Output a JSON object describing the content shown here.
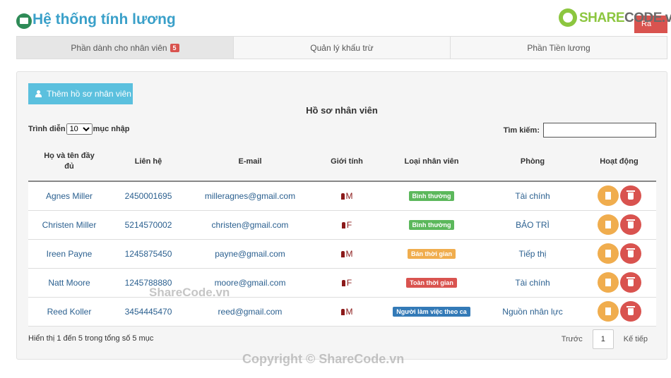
{
  "header": {
    "title": "Hệ thống tính lương",
    "exit_label": "Ra",
    "brand_share": "SHARE",
    "brand_code": "CODE.vn"
  },
  "tabs": [
    {
      "label": "Phần dành cho nhân viên",
      "badge": "5"
    },
    {
      "label": "Quản lý khấu trừ"
    },
    {
      "label": "Phần Tiền lương"
    }
  ],
  "panel": {
    "add_button": "Thêm hồ sơ nhân viên",
    "title": "Hồ sơ nhân viên",
    "show_label": "Trình diễn",
    "show_value": "10",
    "entries_label": "mục nhập",
    "search_label": "Tìm kiếm:",
    "search_value": ""
  },
  "table": {
    "headers": [
      "Họ và tên đầy đủ",
      "Liên hệ",
      "E-mail",
      "Giới tính",
      "Loại nhân viên",
      "Phòng",
      "Hoạt động"
    ],
    "rows": [
      {
        "name": "Agnes Miller",
        "phone": "2450001695",
        "email": "milleragnes@gmail.com",
        "gender": "M",
        "type": "Bình thường",
        "type_color": "#5cb85c",
        "dept": "Tài chính"
      },
      {
        "name": "Christen Miller",
        "phone": "5214570002",
        "email": "christen@gmail.com",
        "gender": "F",
        "type": "Bình thường",
        "type_color": "#5cb85c",
        "dept": "BẢO TRÌ"
      },
      {
        "name": "Ireen Payne",
        "phone": "1245875450",
        "email": "payne@gmail.com",
        "gender": "M",
        "type": "Bán thời gian",
        "type_color": "#f0ad4e",
        "dept": "Tiếp thị"
      },
      {
        "name": "Natt Moore",
        "phone": "1245788880",
        "email": "moore@gmail.com",
        "gender": "F",
        "type": "Toàn thời gian",
        "type_color": "#d9534f",
        "dept": "Tài chính"
      },
      {
        "name": "Reed Koller",
        "phone": "3454445470",
        "email": "reed@gmail.com",
        "gender": "M",
        "type": "Người làm việc theo ca",
        "type_color": "#337ab7",
        "dept": "Nguồn nhân lực"
      }
    ]
  },
  "footer": {
    "info": "Hiển thị 1 đến 5 trong tổng số 5 mục",
    "prev": "Trước",
    "page": "1",
    "next": "Kế tiếp"
  },
  "watermarks": {
    "inline": "ShareCode.vn",
    "copyright": "Copyright © ShareCode.vn"
  }
}
